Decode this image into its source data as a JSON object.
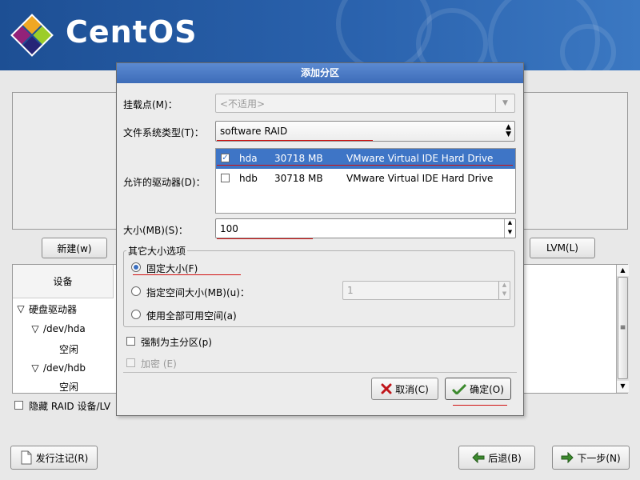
{
  "banner": {
    "logo_text": "CentOS"
  },
  "main": {
    "new_button": "新建(w)",
    "lvm_button": "LVM(L)",
    "device_header": "设备",
    "tree": [
      {
        "label": "硬盘驱动器",
        "expander": "▽"
      },
      {
        "label": "/dev/hda",
        "expander": "▽"
      },
      {
        "label": "空闲"
      },
      {
        "label": "/dev/hdb",
        "expander": "▽"
      },
      {
        "label": "空闲"
      }
    ],
    "hide_raid_label": "隐藏 RAID 设备/LV"
  },
  "dialog": {
    "title": "添加分区",
    "mount_label": "挂载点(M)：",
    "mount_value": "<不适用>",
    "fstype_label": "文件系统类型(T)：",
    "fstype_value": "software RAID",
    "drives_label": "允许的驱动器(D)：",
    "drives": [
      {
        "checked": true,
        "name": "hda",
        "size": "30718 MB",
        "model": "VMware Virtual IDE Hard Drive",
        "selected": true
      },
      {
        "checked": false,
        "name": "hdb",
        "size": "30718 MB",
        "model": "VMware Virtual IDE Hard Drive",
        "selected": false
      }
    ],
    "size_label": "大小(MB)(S)：",
    "size_value": "100",
    "other_size_title": "其它大小选项",
    "opt_fixed": "固定大小(F)",
    "opt_upto": "指定空间大小(MB)(u)：",
    "opt_upto_value": "1",
    "opt_fill": "使用全部可用空间(a)",
    "force_primary": "强制为主分区(p)",
    "encrypt": "加密 (E)",
    "cancel": "取消(C)",
    "ok": "确定(O)"
  },
  "footer": {
    "release_notes": "发行注记(R)",
    "back": "后退(B)",
    "next": "下一步(N)"
  },
  "colors": {
    "banner": "#2a62ad",
    "dialog_title": "#4a7cc6",
    "selection": "#3e75c6",
    "annotation_red": "#d01010"
  }
}
